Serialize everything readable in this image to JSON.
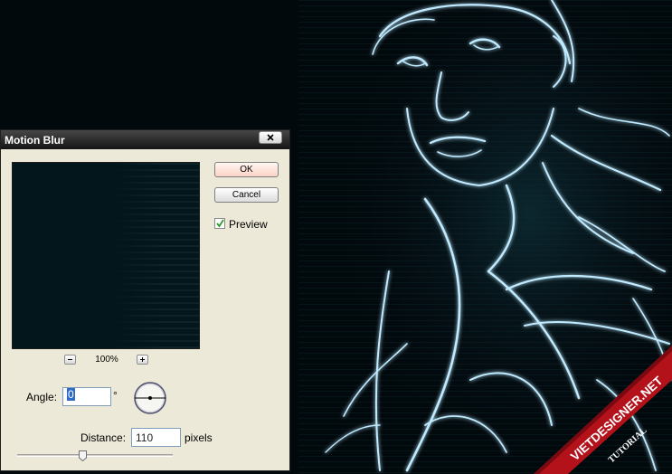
{
  "dialog": {
    "title": "Motion Blur",
    "ok_label": "OK",
    "cancel_label": "Cancel",
    "preview_label": "Preview",
    "preview_checked": true,
    "zoom_level": "100%",
    "angle_label": "Angle:",
    "angle_value": "0",
    "degree_symbol": "°",
    "distance_label": "Distance:",
    "distance_value": "110",
    "distance_unit": "pixels",
    "distance_slider_fraction": 0.42
  },
  "watermark": {
    "site": "VIETDESIGNER.NET",
    "tag": "TUTORIAL"
  },
  "colors": {
    "background": "#02090d",
    "glow": "#bfeaff",
    "ok_button": "#fbd3c4",
    "banner": "#b3121b"
  },
  "icons": {
    "close": "close-icon",
    "zoom_out": "minus-icon",
    "zoom_in": "plus-icon",
    "check": "check-icon",
    "angle_dial": "angle-dial-icon"
  }
}
